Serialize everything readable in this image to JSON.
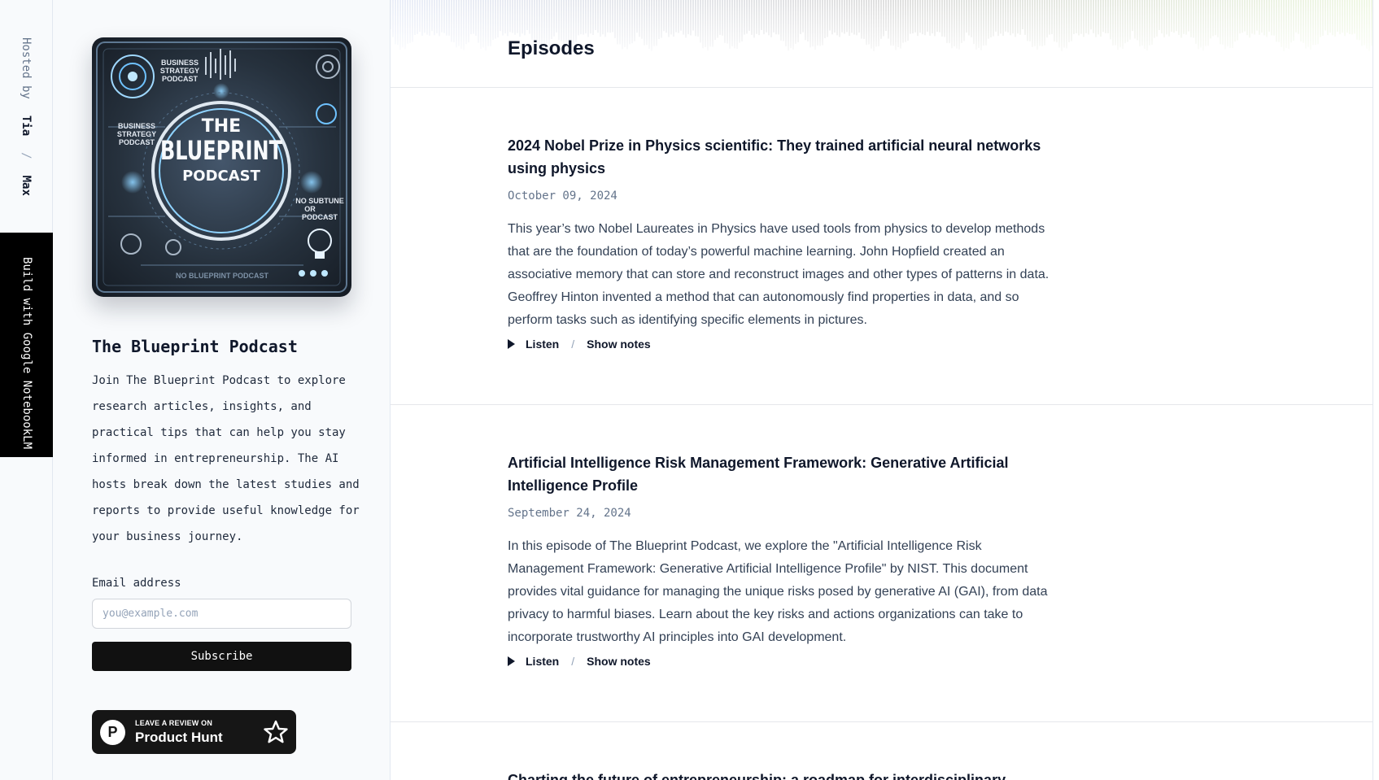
{
  "hosts": {
    "label": "Hosted by",
    "names": [
      "Tia",
      "Max"
    ],
    "separator": "/"
  },
  "side_cta": {
    "label": "Build with Google NotebookLM"
  },
  "podcast": {
    "cover_alt": "The Blueprint Podcast cover art",
    "cover_text": {
      "top_badge_lines": [
        "BUSINESS",
        "STRATEGY",
        "PODCAST"
      ],
      "left_badge_lines": [
        "BUSINESS",
        "STRATEGY",
        "PODCAST"
      ],
      "main_lines": [
        "THE",
        "BLUEPRINT",
        "PODCAST"
      ],
      "right_badge_lines": [
        "NO SUBTUNE",
        "OR",
        "PODCAST"
      ],
      "footer": "NO BLUEPRINT PODCAST"
    },
    "title": "The Blueprint Podcast",
    "description": "Join The Blueprint Podcast to explore research articles, insights, and practical tips that can help you stay informed in entrepreneurship. The AI hosts break down the latest studies and reports to provide useful knowledge for your business journey."
  },
  "subscribe": {
    "email_label": "Email address",
    "email_placeholder": "you@example.com",
    "email_value": "",
    "button_label": "Subscribe"
  },
  "product_hunt": {
    "logo_letter": "P",
    "small_text": "LEAVE A REVIEW ON",
    "big_text": "Product Hunt"
  },
  "episodes_section": {
    "title": "Episodes",
    "listen_label": "Listen",
    "notes_label": "Show notes",
    "separator": "/",
    "items": [
      {
        "title": "2024 Nobel Prize in Physics scientific: They trained artificial neural networks using physics",
        "date": "October 09, 2024",
        "description": "This year’s two Nobel Laureates in Physics have used tools from physics to develop methods that are the foundation of today’s powerful machine learning. John Hopfield created an associative memory that can store and reconstruct images and other types of patterns in data. Geoffrey Hinton invented a method that can autonomously find properties in data, and so perform tasks such as identifying specific elements in pictures."
      },
      {
        "title": "Artificial Intelligence Risk Management Framework: Generative Artificial Intelligence Profile",
        "date": "September 24, 2024",
        "description": "In this episode of The Blueprint Podcast, we explore the \"Artificial Intelligence Risk Management Framework: Generative Artificial Intelligence Profile\" by NIST. This document provides vital guidance for managing the unique risks posed by generative AI (GAI), from data privacy to harmful biases. Learn about the key risks and actions organizations can take to incorporate trustworthy AI principles into GAI development."
      },
      {
        "title": "Charting the future of entrepreneurship: a roadmap for interdisciplinary",
        "date": "",
        "description": ""
      }
    ]
  },
  "colors": {
    "accent_dark": "#111111",
    "page_bg": "#ffffff",
    "sidebar_bg": "#f8fafc",
    "muted_text": "#64748b",
    "wave_start": "#b4c3e6",
    "wave_mid": "#8c8c8c",
    "wave_end": "#c8e6a0"
  }
}
